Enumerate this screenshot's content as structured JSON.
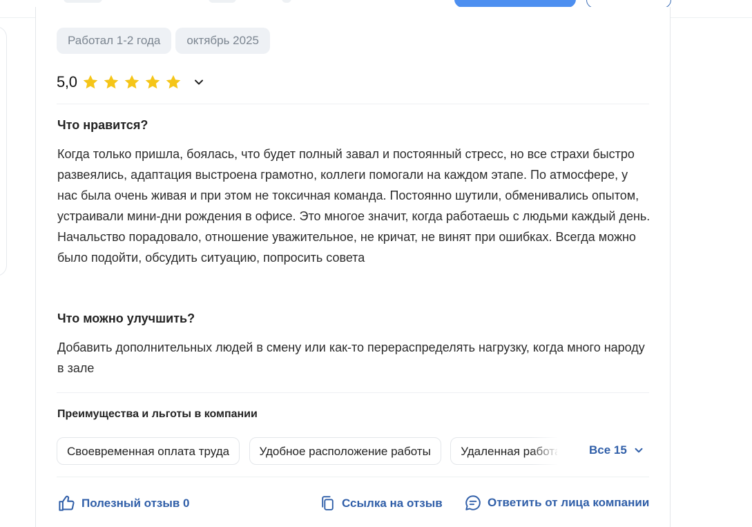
{
  "review": {
    "tags": [
      "Работал 1-2 года",
      "октябрь 2025"
    ],
    "rating": "5,0",
    "rating_stars": 5,
    "likes_title": "Что нравится?",
    "likes_text": "Когда только пришла, боялась, что будет полный завал и постоянный стресс, но все страхи быстро развеялись, адаптация выстроена грамотно, коллеги помогали на каждом этапе. По атмосфере, у нас была очень живая и при этом не токсичная команда. Постоянно шутили, обменивались опытом, устраивали мини-дни рождения в офисе. Это многое значит, когда работаешь с людьми каждый день. Начальство порадовало, отношение уважительное, не кричат, не винят при ошибках. Всегда можно было подойти, обсудить ситуацию, попросить совета",
    "improve_title": "Что можно улучшить?",
    "improve_text": "Добавить дополнительных людей в смену или как-то перераспределять нагрузку, когда много народу в зале",
    "benefits_title": "Преимущества и льготы в компании",
    "benefits": [
      "Своевременная оплата труда",
      "Удобное расположение работы",
      "Удаленная работа"
    ],
    "benefits_all": "Все 15",
    "actions": {
      "useful": "Полезный отзыв 0",
      "link": "Ссылка на отзыв",
      "reply": "Ответить от лица компании"
    }
  },
  "colors": {
    "accent": "#2f5ea8",
    "star": "#f5c518",
    "tag_bg": "#eef1f5",
    "primary_button": "#4d8ff0"
  },
  "icons": [
    "star-icon",
    "chevron-down-icon",
    "thumbs-up-icon",
    "copy-link-icon",
    "chat-icon"
  ]
}
